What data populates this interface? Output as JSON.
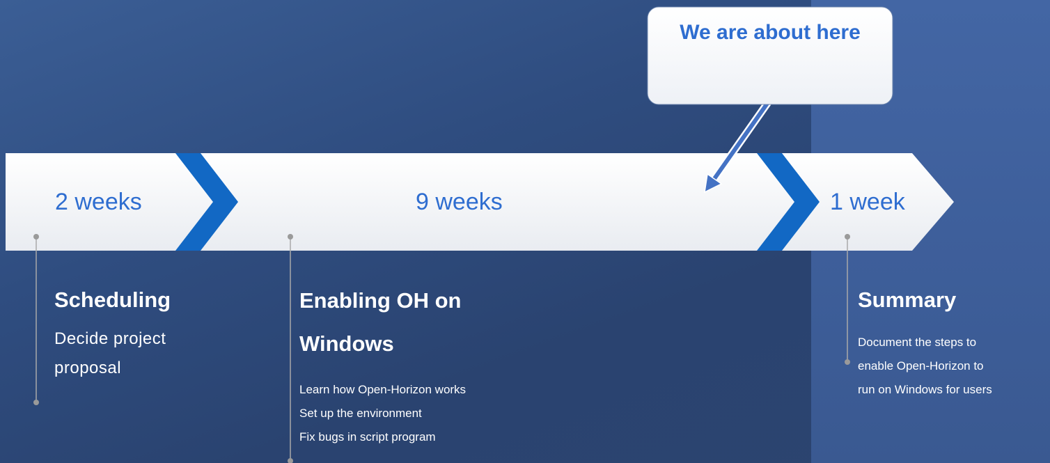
{
  "callout": {
    "text": "We are about here"
  },
  "phases": [
    {
      "duration": "2 weeks",
      "title": "Scheduling",
      "description_lines": [
        "Decide project",
        "proposal"
      ]
    },
    {
      "duration": "9 weeks",
      "title": "Enabling OH on Windows",
      "description_lines": [
        "Learn how Open-Horizon works",
        "Set up the environment",
        "Fix bugs in script program"
      ]
    },
    {
      "duration": "1 week",
      "title": "Summary",
      "description_lines": [
        "Document the steps to",
        "enable Open-Horizon to",
        "run on Windows for users"
      ]
    }
  ],
  "colors": {
    "background": "#2f4d80",
    "right_panel": "#4366a4",
    "arrow_band": "#f4f5f7",
    "chevron": "#1565c0",
    "duration_text": "#2e6dd0",
    "callout_text": "#2e6dd0",
    "pointer_arrow": "#4472c4"
  }
}
